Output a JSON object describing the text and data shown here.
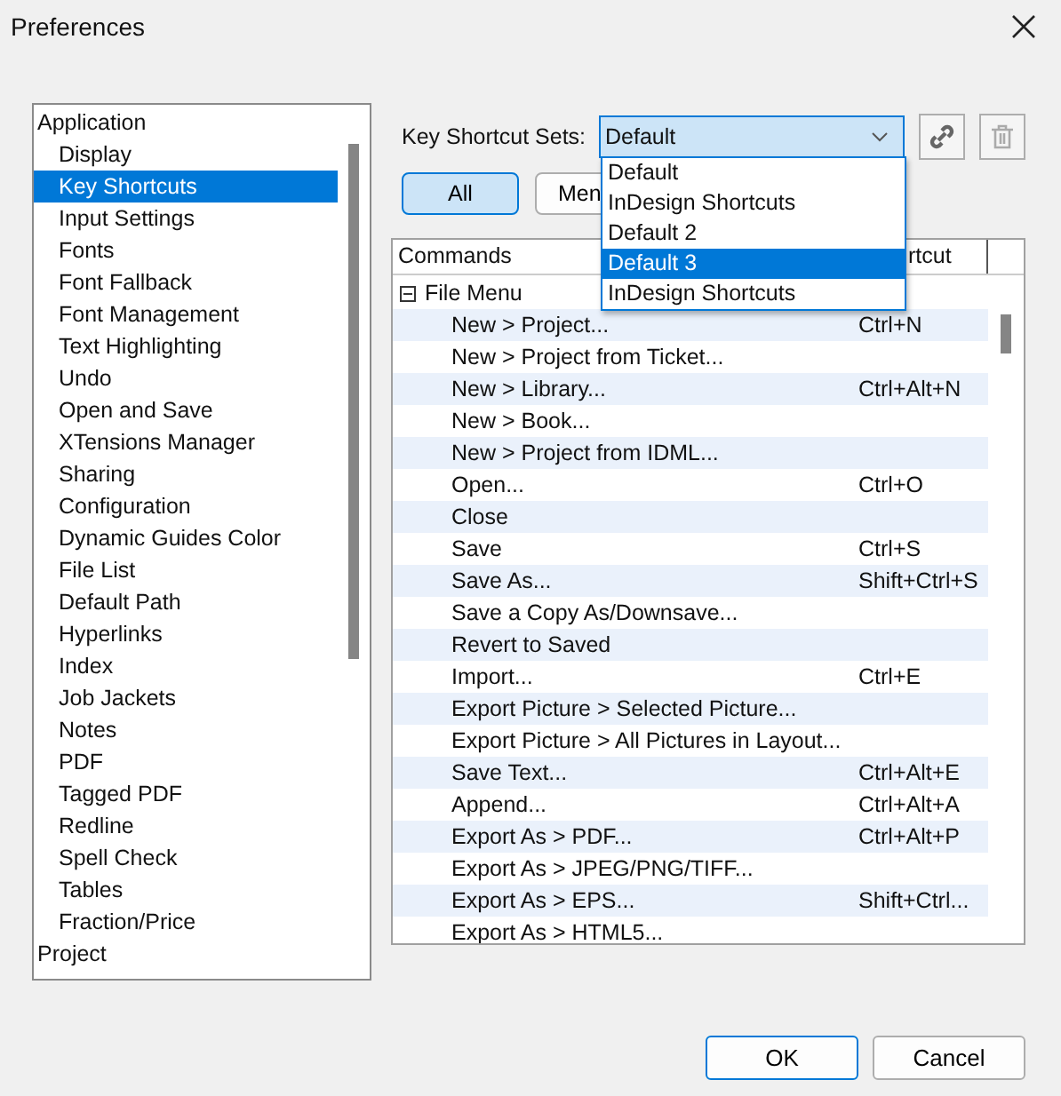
{
  "window": {
    "title": "Preferences"
  },
  "sidebar": {
    "items": [
      {
        "label": "Application",
        "selected": false,
        "children": [
          {
            "label": "Display",
            "selected": false
          },
          {
            "label": "Key Shortcuts",
            "selected": true
          },
          {
            "label": "Input Settings",
            "selected": false
          },
          {
            "label": "Fonts",
            "selected": false
          },
          {
            "label": "Font Fallback",
            "selected": false
          },
          {
            "label": "Font Management",
            "selected": false
          },
          {
            "label": "Text Highlighting",
            "selected": false
          },
          {
            "label": "Undo",
            "selected": false
          },
          {
            "label": "Open and Save",
            "selected": false
          },
          {
            "label": "XTensions Manager",
            "selected": false
          },
          {
            "label": "Sharing",
            "selected": false
          },
          {
            "label": "Configuration",
            "selected": false
          },
          {
            "label": "Dynamic Guides Color",
            "selected": false
          },
          {
            "label": "File List",
            "selected": false
          },
          {
            "label": "Default Path",
            "selected": false
          },
          {
            "label": "Hyperlinks",
            "selected": false
          },
          {
            "label": "Index",
            "selected": false
          },
          {
            "label": "Job Jackets",
            "selected": false
          },
          {
            "label": "Notes",
            "selected": false
          },
          {
            "label": "PDF",
            "selected": false
          },
          {
            "label": "Tagged PDF",
            "selected": false
          },
          {
            "label": "Redline",
            "selected": false
          },
          {
            "label": "Spell Check",
            "selected": false
          },
          {
            "label": "Tables",
            "selected": false
          },
          {
            "label": "Fraction/Price",
            "selected": false
          }
        ]
      },
      {
        "label": "Project",
        "selected": false
      }
    ]
  },
  "key_shortcut_sets": {
    "label": "Key Shortcut Sets:",
    "value": "Default",
    "expanded": true,
    "options": [
      {
        "label": "Default",
        "highlighted": false
      },
      {
        "label": "InDesign Shortcuts",
        "highlighted": false
      },
      {
        "label": "Default 2",
        "highlighted": false
      },
      {
        "label": "Default 3",
        "highlighted": true
      },
      {
        "label": "InDesign Shortcuts",
        "highlighted": false
      }
    ]
  },
  "filter_buttons": [
    {
      "label": "All",
      "selected": true
    },
    {
      "label": "Men",
      "selected": false
    }
  ],
  "table": {
    "columns": [
      "Commands",
      "rtcut"
    ],
    "groups": [
      {
        "label": "File Menu",
        "expanded": true,
        "rows": [
          {
            "command": "New > Project...",
            "shortcut": "Ctrl+N"
          },
          {
            "command": "New > Project from Ticket..."
          },
          {
            "command": "New > Library...",
            "shortcut": "Ctrl+Alt+N"
          },
          {
            "command": "New > Book..."
          },
          {
            "command": "New > Project from IDML..."
          },
          {
            "command": "Open...",
            "shortcut": "Ctrl+O"
          },
          {
            "command": "Close"
          },
          {
            "command": "Save",
            "shortcut": "Ctrl+S"
          },
          {
            "command": "Save As...",
            "shortcut": "Shift+Ctrl+S"
          },
          {
            "command": "Save a Copy As/Downsave..."
          },
          {
            "command": "Revert to Saved"
          },
          {
            "command": "Import...",
            "shortcut": "Ctrl+E"
          },
          {
            "command": "Export Picture > Selected Picture..."
          },
          {
            "command": "Export Picture > All Pictures in Layout..."
          },
          {
            "command": "Save Text...",
            "shortcut": "Ctrl+Alt+E"
          },
          {
            "command": "Append...",
            "shortcut": "Ctrl+Alt+A"
          },
          {
            "command": "Export As > PDF...",
            "shortcut": "Ctrl+Alt+P"
          },
          {
            "command": "Export As > JPEG/PNG/TIFF..."
          },
          {
            "command": "Export As > EPS...",
            "shortcut": "Shift+Ctrl..."
          },
          {
            "command": "Export As > HTML5..."
          }
        ]
      }
    ]
  },
  "buttons": [
    {
      "label": "OK",
      "kind": "primary"
    },
    {
      "label": "Cancel",
      "kind": "secondary"
    }
  ]
}
